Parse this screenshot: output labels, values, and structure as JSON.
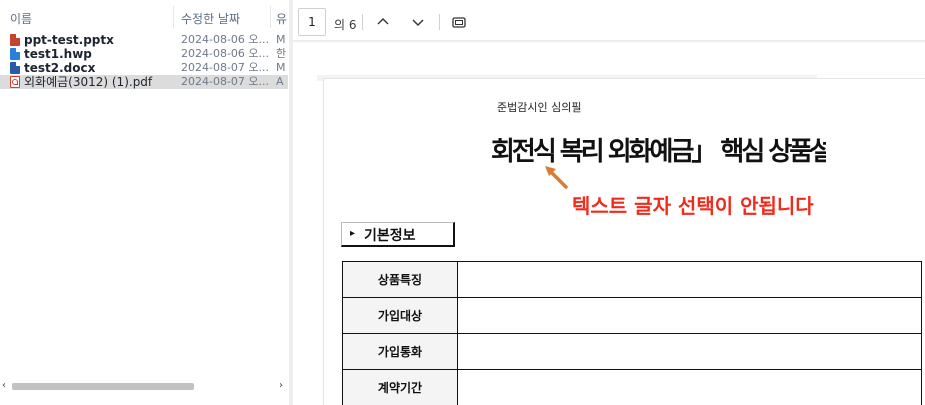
{
  "file_list": {
    "columns": [
      {
        "label": "이름"
      },
      {
        "label": "수정한 날짜"
      },
      {
        "label": "유"
      }
    ],
    "files": [
      {
        "name": "ppt-test.pptx",
        "date": "2024-08-06 오...",
        "type": "M",
        "icon": "pptx-file-icon",
        "selected": false
      },
      {
        "name": "test1.hwp",
        "date": "2024-08-06 오...",
        "type": "한",
        "icon": "hwp-file-icon",
        "selected": false
      },
      {
        "name": "test2.docx",
        "date": "2024-08-07 오...",
        "type": "M",
        "icon": "docx-file-icon",
        "selected": false
      },
      {
        "name": "외화예금(3012) (1).pdf",
        "date": "2024-08-07 오...",
        "type": "A",
        "icon": "pdf-file-icon",
        "selected": true
      }
    ],
    "scroll_left_glyph": "‹",
    "scroll_right_glyph": "›"
  },
  "viewer_toolbar": {
    "page_number": "1",
    "page_total": "의 6",
    "prev_icon": "chevron-up-icon",
    "next_icon": "chevron-down-icon",
    "fit_icon": "fit-page-icon"
  },
  "document": {
    "subtitle": "준법감시인 심의필",
    "title": "회전식 복리 외화예금」 핵심 상품설!",
    "annotation": "텍스트 글자 선택이 안됩니다",
    "annotation_color": "#ef2b1c",
    "section_marker": "▸",
    "section_label": "기본정보",
    "table_rows": [
      {
        "label": "상품특징"
      },
      {
        "label": "가입대상"
      },
      {
        "label": "가입통화"
      },
      {
        "label": "계약기간"
      }
    ]
  }
}
